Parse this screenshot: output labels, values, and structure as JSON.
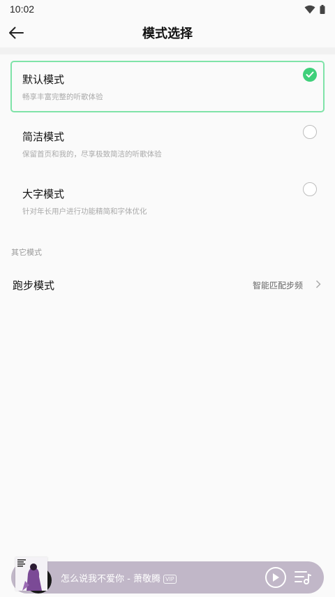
{
  "status_bar": {
    "time": "10:02"
  },
  "header": {
    "title": "模式选择"
  },
  "modes": [
    {
      "title": "默认模式",
      "desc": "畅享丰富完整的听歌体验",
      "selected": true
    },
    {
      "title": "简洁模式",
      "desc": "保留首页和我的，尽享极致简洁的听歌体验",
      "selected": false
    },
    {
      "title": "大字模式",
      "desc": "针对年长用户进行功能精简和字体优化",
      "selected": false
    }
  ],
  "other_section": {
    "label": "其它模式",
    "run_mode": {
      "title": "跑步模式",
      "value": "智能匹配步频"
    }
  },
  "player": {
    "song": "怎么说我不爱你 - 萧敬腾",
    "badge": "VIP"
  },
  "colors": {
    "accent_green": "#3fd07a",
    "selected_border": "#7fe3a8",
    "player_bg": "#c1b7c8"
  },
  "icons": [
    "wifi-icon",
    "battery-icon",
    "back-arrow-icon",
    "check-icon",
    "chevron-right-icon",
    "play-icon",
    "playlist-icon"
  ]
}
